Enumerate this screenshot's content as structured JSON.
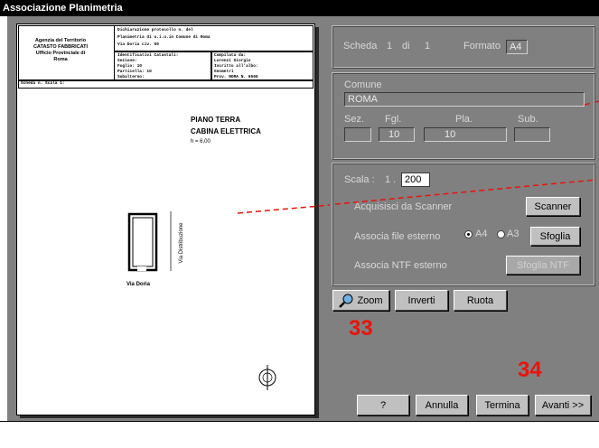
{
  "window": {
    "title": "Associazione Planimetria"
  },
  "sheet": {
    "header_left": [
      "Agenzia del Territorio",
      "CATASTO FABBRICATI",
      "Ufficio Provinciale di",
      "Roma"
    ],
    "header_mid_1": "Dichiarazione protocollo n.        del",
    "header_mid_2": "Planimetria di u.i.u.in Comune di Roma",
    "header_mid_3": "Via Doria                                 civ. 50",
    "ident_1": "Identificativi Catastali:",
    "ident_2": "Sezione:",
    "ident_3": "Foglio: 10",
    "ident_4": "Particella: 10",
    "ident_5": "Subalterno:",
    "compiled_1": "Compilata da:",
    "compiled_2": "Lorenzi Giorgio",
    "compiled_3": "Iscritto all'albo:",
    "compiled_4": "Geometri",
    "compiled_5": "Prov. ROMA          N. 6560",
    "scheda_label": "Scheda n.      Scala 1:",
    "floor": "PIANO TERRA",
    "room": "CABINA ELETTRICA",
    "height": "h = 6,00",
    "street_vertical": "Via Distribuzione",
    "street_bottom": "Via Doria"
  },
  "scheda": {
    "label": "Scheda",
    "current": "1",
    "of_label": "di",
    "total": "1",
    "format_label": "Formato",
    "format_value": "A4"
  },
  "location": {
    "comune_label": "Comune",
    "comune_value": "ROMA",
    "sez_label": "Sez.",
    "sez_value": "",
    "fgl_label": "Fgl.",
    "fgl_value": "10",
    "pla_label": "Pla.",
    "pla_value": "10",
    "sub_label": "Sub.",
    "sub_value": ""
  },
  "scale": {
    "label": "Scala :",
    "prefix": "1 .",
    "value": "200"
  },
  "acquire": {
    "scanner_label": "Acquisisci da Scanner",
    "scanner_button": "Scanner",
    "file_label": "Associa file esterno",
    "radio_a4": "A4",
    "radio_a3": "A3",
    "selected_format": "A4",
    "browse_button": "Sfoglia",
    "ntf_label": "Associa NTF esterno",
    "ntf_button": "Sfoglia NTF"
  },
  "tools": {
    "zoom": "Zoom",
    "invert": "Inverti",
    "rotate": "Ruota"
  },
  "annotations": {
    "a": "33",
    "b": "34"
  },
  "footer": {
    "help": "?",
    "cancel": "Annulla",
    "finish": "Termina",
    "next": "Avanti >>"
  },
  "colors": {
    "panel": "#808080",
    "annotation": "#e8140c",
    "titlebar": "#000000"
  }
}
